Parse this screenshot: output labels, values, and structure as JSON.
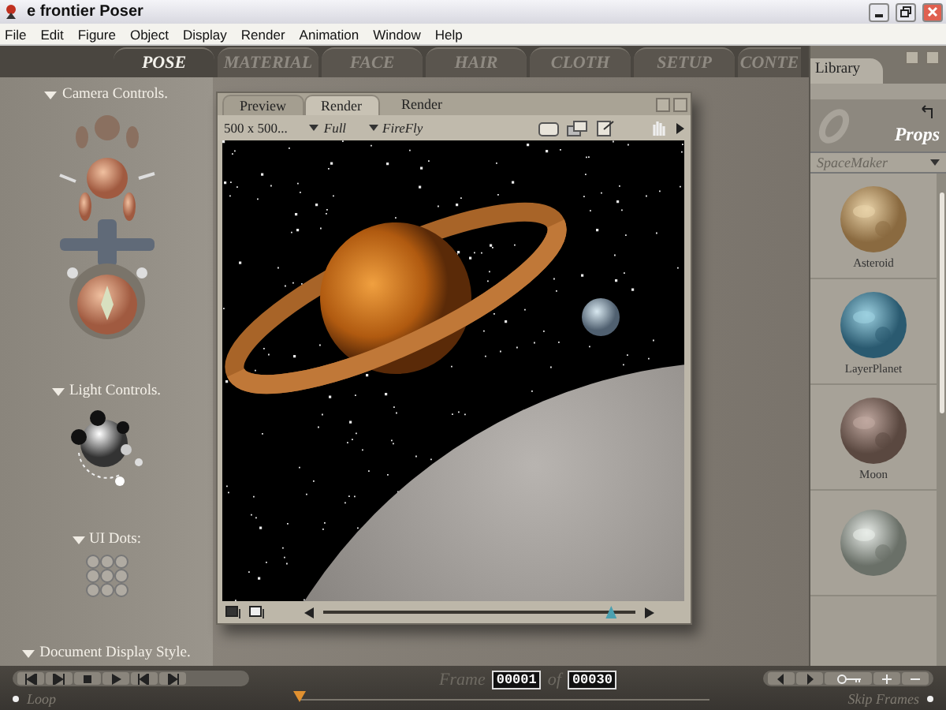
{
  "window": {
    "title": "e frontier Poser"
  },
  "menu": [
    "File",
    "Edit",
    "Figure",
    "Object",
    "Display",
    "Render",
    "Animation",
    "Window",
    "Help"
  ],
  "tabs": [
    {
      "label": "POSE",
      "selected": true
    },
    {
      "label": "MATERIAL",
      "selected": false
    },
    {
      "label": "FACE",
      "selected": false
    },
    {
      "label": "HAIR",
      "selected": false
    },
    {
      "label": "CLOTH",
      "selected": false
    },
    {
      "label": "SETUP",
      "selected": false
    },
    {
      "label": "CONTE",
      "selected": false
    }
  ],
  "left_panel": {
    "sections": [
      {
        "title": "Camera Controls.",
        "kind": "camera"
      },
      {
        "title": "Light Controls.",
        "kind": "light"
      },
      {
        "title": "UI Dots:",
        "kind": "dots"
      },
      {
        "title": "Document Display Style.",
        "kind": "style"
      }
    ]
  },
  "document": {
    "tabs": [
      {
        "label": "Preview",
        "selected": false
      },
      {
        "label": "Render",
        "selected": true
      }
    ],
    "title": "Render",
    "size": "500 x 500...",
    "display": "Full",
    "renderer": "FireFly",
    "slider": {
      "level": 0.92
    }
  },
  "library": {
    "title": "Library",
    "category": "Props",
    "folder": "SpaceMaker",
    "items": [
      {
        "kind": "prop",
        "label": "Asteroid"
      },
      {
        "kind": "prop",
        "label": "LayerPlanet"
      },
      {
        "kind": "prop",
        "label": "Moon"
      },
      {
        "kind": "prop"
      }
    ]
  },
  "playback": {
    "loop_label": "Loop",
    "frame_label": "Frame",
    "frame": "00001",
    "of_label": "of",
    "total": "00030",
    "timeline": {
      "level": 0
    },
    "skip_label": "Skip Frames"
  }
}
